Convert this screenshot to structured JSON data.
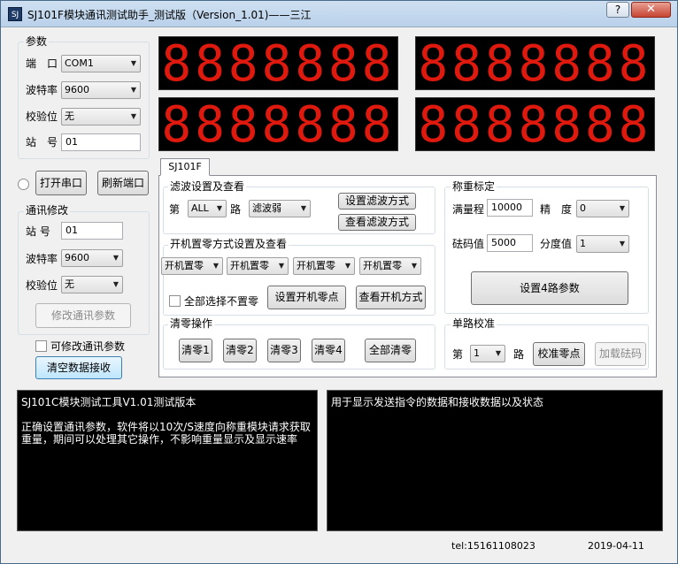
{
  "window": {
    "title": "SJ101F模块通讯测试助手_测试版（Version_1.01)——三江",
    "icon_text": "SJ",
    "help_label": "?",
    "close_label": "✕"
  },
  "params": {
    "group_label": "参数",
    "port_label": "端　口",
    "port_value": "COM1",
    "baud_label": "波特率",
    "baud_value": "9600",
    "parity_label": "校验位",
    "parity_value": "无",
    "station_label": "站　号",
    "station_value": "01"
  },
  "serial": {
    "open_label": "打开串口",
    "refresh_label": "刷新端口"
  },
  "comm_edit": {
    "group_label": "通讯修改",
    "station_label": "站 号",
    "station_value": "01",
    "baud_label": "波特率",
    "baud_value": "9600",
    "parity_label": "校验位",
    "parity_value": "无",
    "modify_label": "修改通讯参数",
    "allow_modify_label": "可修改通讯参数",
    "clear_recv_label": "清空数据接收"
  },
  "displays": {
    "d1": "8888888",
    "d2": "8888888",
    "d3": "8888888",
    "d4": "8888888"
  },
  "tab": {
    "label": "SJ101F"
  },
  "filter": {
    "group_label": "滤波设置及查看",
    "prefix": "第",
    "channel_value": "ALL",
    "suffix": "路",
    "level_value": "滤波弱",
    "set_label": "设置滤波方式",
    "view_label": "查看滤波方式"
  },
  "poweron": {
    "group_label": "开机置零方式设置及查看",
    "combos": [
      "开机置零",
      "开机置零",
      "开机置零",
      "开机置零"
    ],
    "all_no_zero_label": "全部选择不置零",
    "set_label": "设置开机零点",
    "view_label": "查看开机方式"
  },
  "zero": {
    "group_label": "清零操作",
    "buttons": [
      "清零1",
      "清零2",
      "清零3",
      "清零4"
    ],
    "all_label": "全部清零"
  },
  "calib": {
    "group_label": "称重标定",
    "full_range_label": "满量程",
    "full_range_value": "10000",
    "precision_label": "精　度",
    "precision_value": "0",
    "weight_label": "砝码值",
    "weight_value": "5000",
    "division_label": "分度值",
    "division_value": "1",
    "set4_label": "设置4路参数"
  },
  "single": {
    "group_label": "单路校准",
    "prefix": "第",
    "channel_value": "1",
    "suffix": "路",
    "zero_label": "校准零点",
    "load_label": "加载砝码"
  },
  "console_left": {
    "text": "SJ101C模块测试工具V1.01测试版本\n\n正确设置通讯参数，软件将以10次/S速度向称重模块请求获取重量，期间可以处理其它操作，不影响重量显示及显示速率"
  },
  "console_right": {
    "text": "用于显示发送指令的数据和接收数据以及状态"
  },
  "status": {
    "tel": "tel:15161108023",
    "date": "2019-04-11"
  },
  "colors": {
    "display_digit": "#e0190f",
    "display_bg": "#000000",
    "console_bg": "#000000",
    "close_button": "#c74432"
  }
}
